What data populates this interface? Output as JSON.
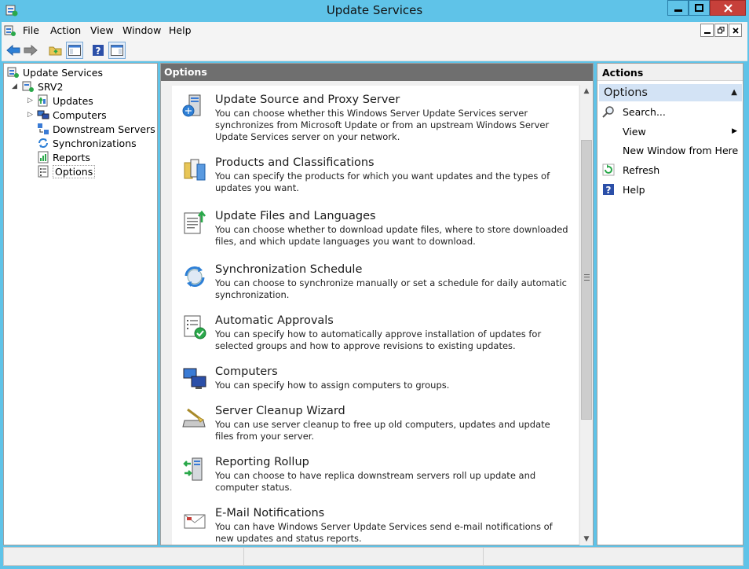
{
  "window": {
    "title": "Update Services"
  },
  "menu": {
    "items": [
      "File",
      "Action",
      "View",
      "Window",
      "Help"
    ]
  },
  "tree": {
    "root": "Update Services",
    "server": "SRV2",
    "children": [
      "Updates",
      "Computers",
      "Downstream Servers",
      "Synchronizations",
      "Reports",
      "Options"
    ],
    "selected": "Options"
  },
  "center": {
    "header": "Options",
    "options": [
      {
        "title": "Update Source and Proxy Server",
        "desc": "You can choose whether this Windows Server Update Services server synchronizes from Microsoft Update or from an upstream Windows Server Update Services server on your network.",
        "icon": "server-source-icon"
      },
      {
        "title": "Products and Classifications",
        "desc": "You can specify the products for which you want updates and the types of updates you want.",
        "icon": "products-icon"
      },
      {
        "title": "Update Files and Languages",
        "desc": "You can choose whether to download update files, where to store downloaded files, and which update languages you want to download.",
        "icon": "files-languages-icon"
      },
      {
        "title": "Synchronization Schedule",
        "desc": "You can choose to synchronize manually or set a schedule for daily automatic synchronization.",
        "icon": "sync-schedule-icon"
      },
      {
        "title": "Automatic Approvals",
        "desc": "You can specify how to automatically approve installation of updates for selected groups and how to approve revisions to existing updates.",
        "icon": "approvals-icon"
      },
      {
        "title": "Computers",
        "desc": "You can specify how to assign computers to groups.",
        "icon": "computers-icon"
      },
      {
        "title": "Server Cleanup Wizard",
        "desc": "You can use server cleanup to free up old computers, updates and update files from your server.",
        "icon": "cleanup-icon"
      },
      {
        "title": "Reporting Rollup",
        "desc": "You can choose to have replica downstream servers roll up update and computer status.",
        "icon": "reporting-rollup-icon"
      },
      {
        "title": "E-Mail Notifications",
        "desc": "You can have Windows Server Update Services send e-mail notifications of new updates and status reports.",
        "icon": "email-icon"
      }
    ]
  },
  "actions": {
    "header": "Actions",
    "section": "Options",
    "items": [
      "Search...",
      "View",
      "New Window from Here",
      "Refresh",
      "Help"
    ]
  }
}
